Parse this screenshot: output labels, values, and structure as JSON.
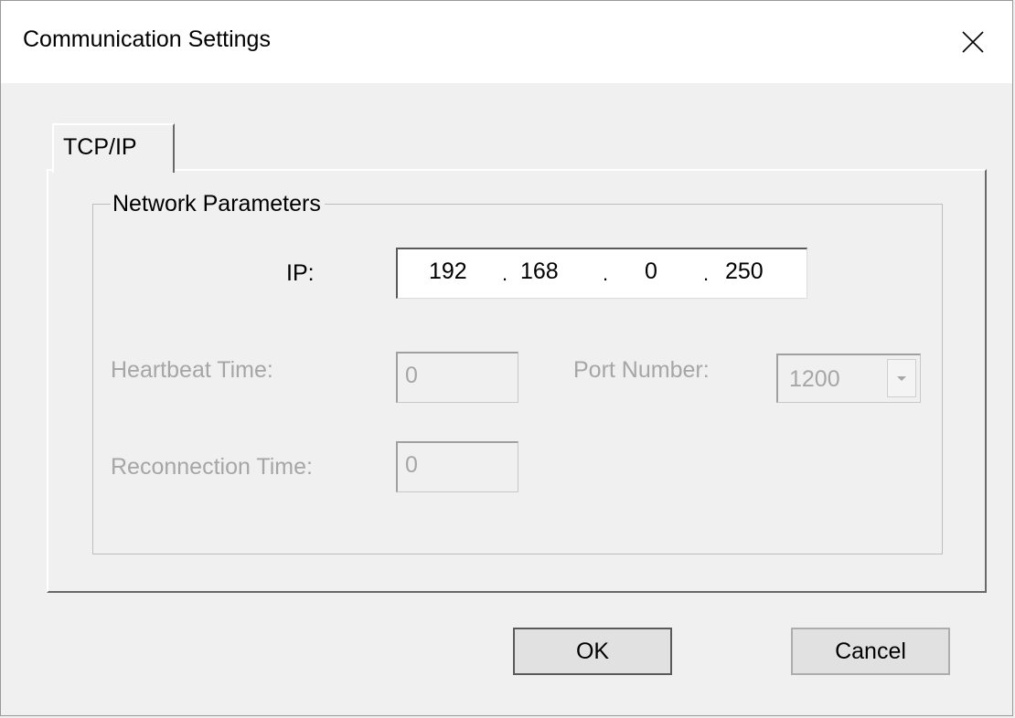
{
  "window": {
    "title": "Communication Settings",
    "close_icon": "close-icon"
  },
  "tabs": [
    {
      "label": "TCP/IP",
      "selected": true
    }
  ],
  "group": {
    "label": "Network Parameters"
  },
  "ip": {
    "label": "IP:",
    "octets": [
      "192",
      "168",
      "0",
      "250"
    ],
    "separator": "."
  },
  "heartbeat": {
    "label": "Heartbeat Time:",
    "value": "0",
    "enabled": false
  },
  "reconnection": {
    "label": "Reconnection Time:",
    "value": "0",
    "enabled": false
  },
  "port": {
    "label": "Port Number:",
    "value": "1200",
    "enabled": false,
    "dropdown_icon": "chevron-down-icon"
  },
  "buttons": {
    "ok": "OK",
    "cancel": "Cancel"
  },
  "colors": {
    "dialog_bg": "#f0f0f0",
    "titlebar_bg": "#ffffff",
    "disabled_text": "#a6a6a6",
    "button_bg": "#e1e1e1"
  }
}
